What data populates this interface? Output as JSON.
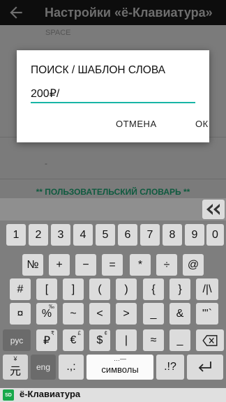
{
  "appbar": {
    "title": "Настройки «ё-Клавиатура»"
  },
  "settings": {
    "space_label": "SPACE",
    "dash": "-",
    "user_dict": "** ПОЛЬЗОВАТЕЛЬСКИЙ СЛОВАРЬ **"
  },
  "dialog": {
    "title": "ПОИСК / ШАБЛОН СЛОВА",
    "input_value": "200₽/",
    "cancel": "ОТМЕНА",
    "ok": "ОК"
  },
  "keyboard": {
    "digits": [
      "1",
      "2",
      "3",
      "4",
      "5",
      "6",
      "7",
      "8",
      "9",
      "0"
    ],
    "row2": [
      "№",
      "+",
      "−",
      "=",
      "*",
      "÷",
      "@"
    ],
    "row3": [
      "#",
      "[",
      "]",
      "(",
      ")",
      "{",
      "}",
      "/|\\"
    ],
    "row4": [
      "¤",
      "%",
      "~",
      "<",
      ">",
      "_",
      "&",
      "\"'`"
    ],
    "row4_sup": [
      "",
      "‰",
      "",
      "",
      "",
      "",
      "",
      ""
    ],
    "row5_lang": "рус",
    "row5": [
      "₽",
      "€",
      "$",
      "|",
      "≈",
      "_"
    ],
    "row5_sup": [
      "₹",
      "£",
      "¢",
      "",
      "",
      ""
    ],
    "row6": {
      "yen": "元",
      "yen_sup": "¥",
      "eng": "eng",
      "punct": ".,:",
      "symbols": "символы",
      "symbols_sup": "…—",
      "excl": ".!?"
    }
  },
  "bottombar": {
    "icon_text": "SD",
    "app_name": "ё-Клавиатура"
  }
}
